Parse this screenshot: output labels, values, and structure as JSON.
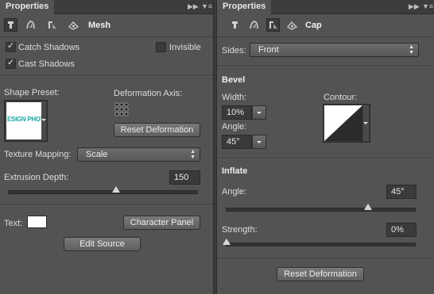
{
  "left": {
    "tab_title": "Properties",
    "mode_label": "Mesh",
    "catch_shadows": {
      "label": "Catch Shadows",
      "checked": true
    },
    "cast_shadows": {
      "label": "Cast Shadows",
      "checked": true
    },
    "invisible": {
      "label": "Invisible",
      "checked": false
    },
    "shape_preset_label": "Shape Preset:",
    "preset_thumb_text": "ESIGN PHOTOP",
    "deformation_axis_label": "Deformation Axis:",
    "reset_deformation": "Reset Deformation",
    "texture_mapping_label": "Texture Mapping:",
    "texture_mapping_value": "Scale",
    "extrusion_depth_label": "Extrusion Depth:",
    "extrusion_depth_value": "150",
    "extrusion_slider_fraction": 0.57,
    "text_label": "Text:",
    "text_color": "#ffffff",
    "character_panel": "Character Panel",
    "edit_source": "Edit Source"
  },
  "right": {
    "tab_title": "Properties",
    "mode_label": "Cap",
    "sides_label": "Sides:",
    "sides_value": "Front",
    "bevel_heading": "Bevel",
    "width_label": "Width:",
    "width_value": "10%",
    "contour_label": "Contour:",
    "angle_label": "Angle:",
    "bevel_angle_value": "45°",
    "inflate_heading": "Inflate",
    "inflate_angle_label": "Angle:",
    "inflate_angle_value": "45°",
    "inflate_angle_fraction": 0.75,
    "strength_label": "Strength:",
    "strength_value": "0%",
    "strength_fraction": 0.0,
    "reset_deformation": "Reset Deformation"
  },
  "colors": {
    "panel_bg": "#535353",
    "tabbar_bg": "#3c3c3c",
    "accent_teal": "#1aa5a5"
  },
  "icons": [
    "mesh-icon",
    "deform-icon",
    "cap-icon",
    "coordinates-icon",
    "panel-menu-icon",
    "collapse-icon"
  ]
}
